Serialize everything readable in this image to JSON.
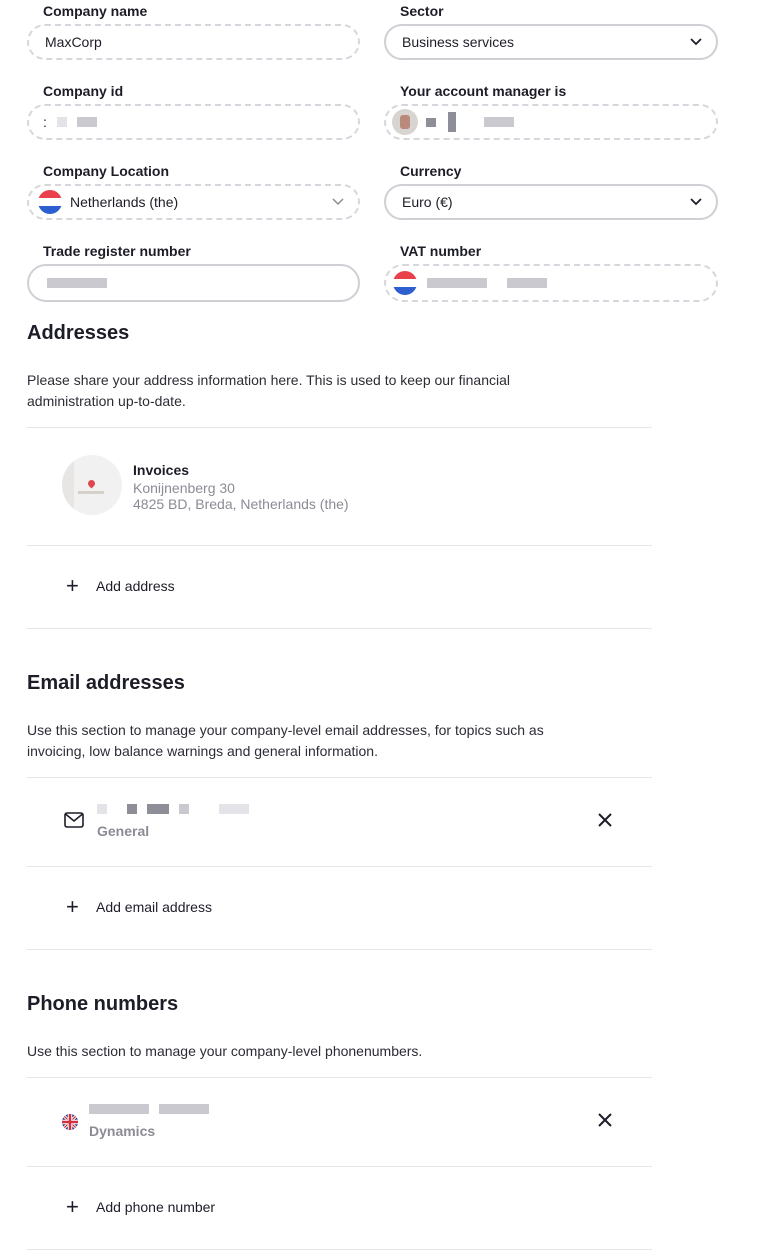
{
  "company": {
    "name_label": "Company name",
    "name_value": "MaxCorp",
    "sector_label": "Sector",
    "sector_value": "Business services",
    "id_label": "Company id",
    "id_value": ":",
    "account_manager_label": "Your account manager is",
    "location_label": "Company Location",
    "location_value": "Netherlands (the)",
    "currency_label": "Currency",
    "currency_value": "Euro (€)",
    "trade_label": "Trade register number",
    "vat_label": "VAT number"
  },
  "addresses": {
    "title": "Addresses",
    "description": "Please share your address information here. This is used to keep our financial administration up-to-date.",
    "items": [
      {
        "type": "Invoices",
        "line1": "Konijnenberg 30",
        "line2": "4825 BD, Breda, Netherlands (the)"
      }
    ],
    "add_label": "Add address"
  },
  "emails": {
    "title": "Email addresses",
    "description": "Use this section to manage your company-level email addresses, for topics such as invoicing, low balance warnings and general information.",
    "items": [
      {
        "type": "General"
      }
    ],
    "add_label": "Add email address"
  },
  "phones": {
    "title": "Phone numbers",
    "description": "Use this section to manage your company-level phonenumbers.",
    "items": [
      {
        "type": "Dynamics"
      }
    ],
    "add_label": "Add phone number"
  },
  "icons": {
    "chevron": "chevron-down-icon",
    "close": "close-icon",
    "plus": "plus-icon",
    "mail": "mail-icon",
    "flag_nl": "netherlands-flag-icon",
    "flag_uk": "uk-flag-icon",
    "map": "map-thumbnail-icon"
  },
  "colors": {
    "text": "#1d1d28",
    "muted": "#8b8b95",
    "border": "#cfd0d6",
    "dashed_border": "#d6d6dc",
    "divider": "#e6e6ea"
  }
}
